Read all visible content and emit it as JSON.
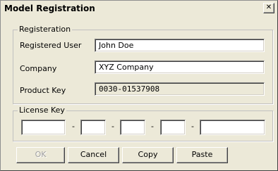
{
  "window": {
    "title": "Model Registration",
    "close_glyph": "✕"
  },
  "registration": {
    "legend": "Registeration",
    "registered_user_label": "Registered User",
    "registered_user_value": "John Doe",
    "company_label": "Company",
    "company_value": "XYZ Company",
    "product_key_label": "Product Key",
    "product_key_value": "0030-01537908"
  },
  "license": {
    "legend": "License Key",
    "separators": [
      "-",
      "-",
      "-",
      "-"
    ],
    "fields": [
      "",
      "",
      "",
      "",
      ""
    ]
  },
  "buttons": {
    "ok": "OK",
    "cancel": "Cancel",
    "copy": "Copy",
    "paste": "Paste"
  }
}
